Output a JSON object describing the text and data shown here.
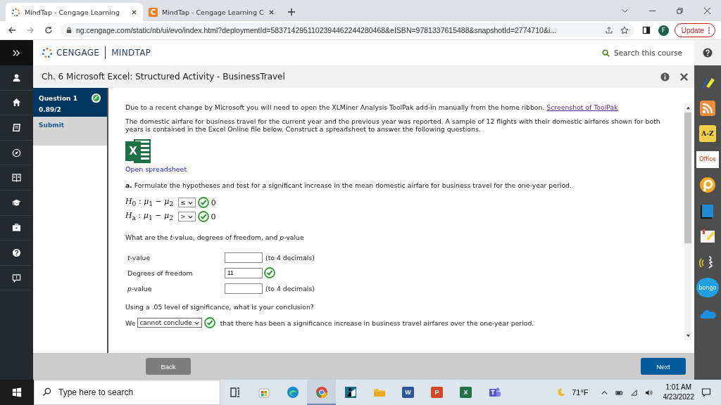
{
  "browser": {
    "tabs": [
      {
        "title": "MindTap - Cengage Learning",
        "kind": "dots",
        "selected": true
      },
      {
        "title": "MindTap - Cengage Learning C",
        "kind": "letter",
        "icon_letter": "C",
        "selected": false
      }
    ],
    "url": "ng.cengage.com/static/nb/ui/evo/index.html?deploymentId=5837142951102394462244280468&eISBN=9781337615488&snapshotId=2774710&i...",
    "profile_initial": "F",
    "update_label": "Update"
  },
  "header": {
    "brand": "CENGAGE",
    "product": "MINDTAP",
    "search": "Search this course"
  },
  "title": "Ch. 6 Microsoft Excel: Structured Activity - BusinessTravel",
  "question_panel": [
    {
      "kind": "question",
      "label": "Question 1",
      "score": "0.89/2",
      "selected": true
    },
    {
      "kind": "action",
      "label": "Submit",
      "selected": false
    }
  ],
  "content": {
    "notice": "Due to a recent change by Microsoft you will need to open the XLMiner Analysis ToolPak add-in manually from the home ribbon.",
    "notice_link": "Screenshot of ToolPak",
    "intro": "The domestic airfare for business travel for the current year and the previous year was reported. A sample of 12 flights with their domestic airfares shown for both years is contained in the Excel Online file below. Construct a spreadsheet to answer the following questions.",
    "spreadsheet_icon_letter": "X",
    "spreadsheet_link": "Open spreadsheet",
    "part_a": "**a.** Formulate the hypotheses and test for a significant increase in the mean domestic airfare for business travel for the one-year period.",
    "hypotheses": [
      {
        "lhs": "*H*$_{0}$ : *μ*$_{1}$ − *μ*$_{2}$",
        "operator": "≤",
        "correct": true,
        "rhs": "0"
      },
      {
        "lhs": "*H*$_{a}$ : *μ*$_{1}$ − *μ*$_{2}$",
        "operator": ">",
        "correct": true,
        "rhs": "0"
      }
    ],
    "stats_question": "What are the *t*-value, degrees of freedom, and *p*-value",
    "fields": [
      {
        "label": "*t*-value",
        "hint": "(to 4 decimals)",
        "correct": false
      },
      {
        "label": "Degrees of freedom",
        "value": "11",
        "correct": true
      },
      {
        "label": "*p*-value",
        "hint": "(to 4 decimals)",
        "correct": false
      }
    ],
    "conclusion_question": "Using a .05 level of significance, what is your conclusion?",
    "conclusion": {
      "prefix": "We",
      "choice": "cannot conclude",
      "correct": true,
      "suffix": "that there has been a significance increase in business travel airfares over the one-year period."
    }
  },
  "footer": {
    "back": "Back",
    "next": "Next"
  },
  "tools": [
    {
      "kind": "pen"
    },
    {
      "kind": "rss"
    },
    {
      "kind": "az",
      "label": "A-Z"
    },
    {
      "kind": "office",
      "label": "Office"
    },
    {
      "kind": "ring"
    },
    {
      "kind": "book"
    },
    {
      "kind": "note"
    },
    {
      "kind": "speech"
    },
    {
      "kind": "bongo",
      "label": "bongo"
    },
    {
      "kind": "cloud"
    }
  ],
  "taskbar": {
    "search_placeholder": "Type here to search",
    "apps": [
      {
        "kind": "taskview",
        "selected": false
      },
      {
        "kind": "store",
        "selected": false
      },
      {
        "kind": "edge",
        "selected": false
      },
      {
        "kind": "chrome",
        "selected": true
      },
      {
        "kind": "reader",
        "selected": false
      },
      {
        "kind": "files",
        "selected": false
      },
      {
        "kind": "office",
        "label": "W",
        "color": "#2b579a",
        "selected": false
      },
      {
        "kind": "office",
        "label": "P",
        "color": "#d24726",
        "selected": false
      },
      {
        "kind": "office",
        "label": "X",
        "color": "#217346",
        "selected": false
      },
      {
        "kind": "teams",
        "selected": false
      }
    ],
    "temperature": "71°F",
    "time": "1:01 AM",
    "date": "4/23/2022"
  }
}
